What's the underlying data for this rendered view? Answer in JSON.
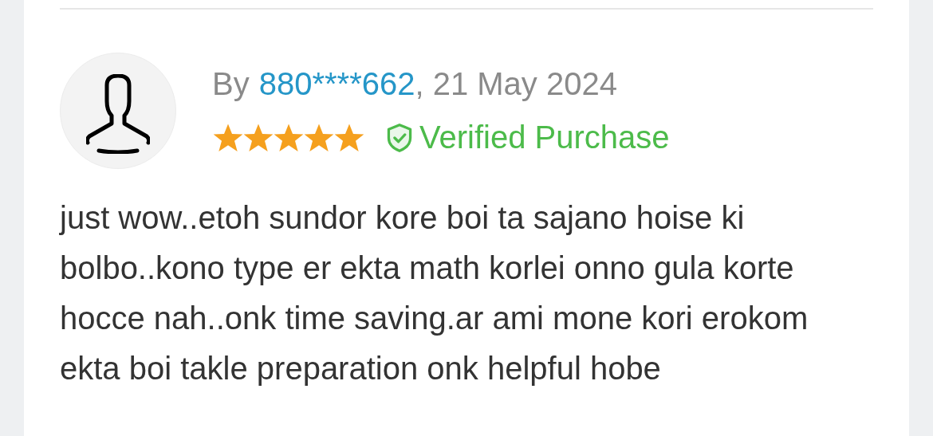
{
  "review": {
    "by_label": "By",
    "reviewer": "880****662",
    "date": ", 21 May 2024",
    "stars": 5,
    "verified_label": "Verified Purchase",
    "text": "just wow..etoh sundor kore boi ta sajano hoise ki bolbo..kono type er ekta math korlei onno gula korte hocce nah..onk time saving.ar ami mone kori erokom ekta boi takle preparation onk helpful hobe"
  }
}
